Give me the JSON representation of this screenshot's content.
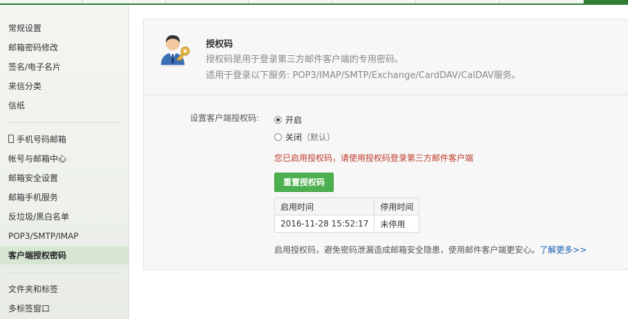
{
  "sidebar": {
    "group1": [
      "常规设置",
      "邮箱密码修改",
      "签名/电子名片",
      "来信分类",
      "信纸"
    ],
    "group2": [
      "手机号码邮箱",
      "帐号与邮箱中心",
      "邮箱安全设置",
      "邮箱手机服务",
      "反垃圾/黑白名单",
      "POP3/SMTP/IMAP",
      "客户端授权密码"
    ],
    "group3": [
      "文件夹和标签",
      "多标签窗口"
    ],
    "active_item": "客户端授权密码"
  },
  "header": {
    "title": "授权码",
    "description": "授权码是用于登录第三方邮件客户端的专用密码。",
    "services": "适用于登录以下服务: POP3/IMAP/SMTP/Exchange/CardDAV/CalDAV服务。",
    "icon": "user-key-icon"
  },
  "setting": {
    "label": "设置客户端授权码:",
    "option_on": "开启",
    "option_off": "关闭",
    "option_off_note": "（默认）",
    "selected": "开启"
  },
  "notice": "您已启用授权码，请使用授权码登录第三方邮件客户端",
  "reset_button": "重置授权码",
  "table": {
    "headers": [
      "启用时间",
      "停用时间"
    ],
    "rows": [
      [
        "2016-11-28 15:52:17",
        "未停用"
      ]
    ]
  },
  "footer": {
    "text": "启用授权码，避免密码泄漏造成邮箱安全隐患，使用邮件客户端更安心。",
    "link": "了解更多>>"
  },
  "colors": {
    "accent_green": "#4caf50",
    "brand_green": "#2e7d32",
    "notice_red": "#c0392b",
    "link_blue": "#1a5fb4"
  }
}
